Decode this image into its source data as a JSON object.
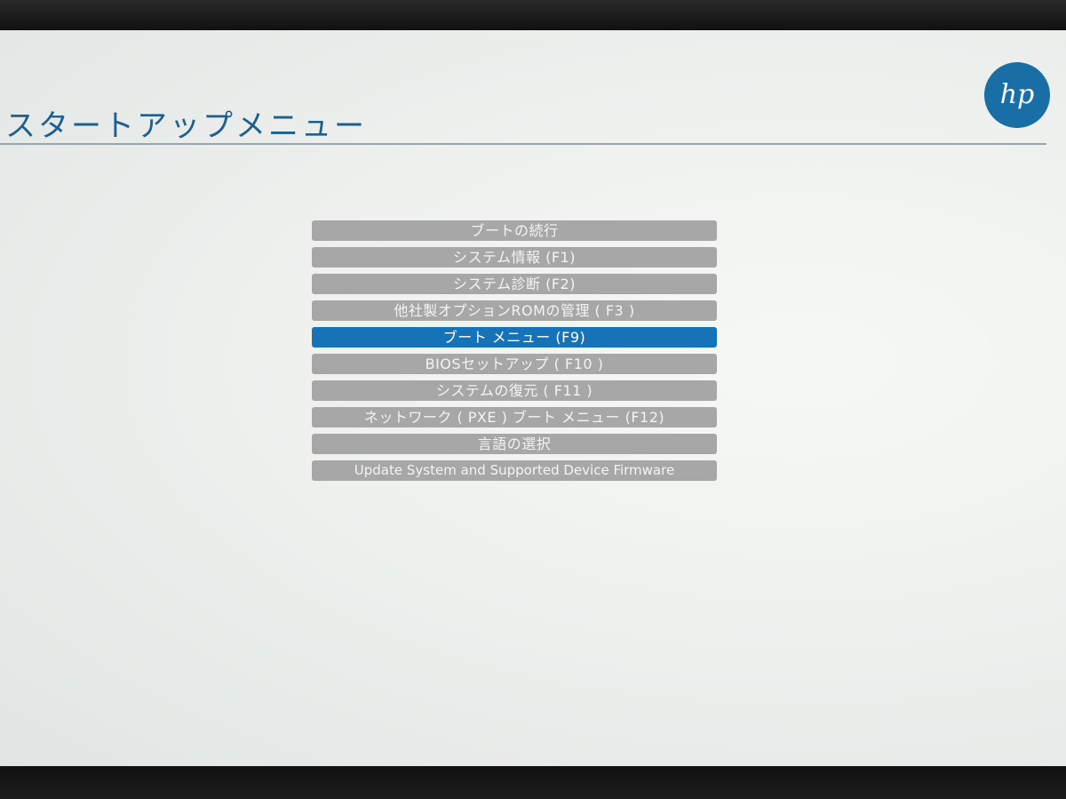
{
  "header": {
    "title": "スタートアップメニュー",
    "logo_icon": "hp-logo-icon"
  },
  "menu": {
    "selected_index": 4,
    "items": [
      {
        "label": "ブートの続行"
      },
      {
        "label": "システム情報 (F1)"
      },
      {
        "label": "システム診断 (F2)"
      },
      {
        "label": "他社製オプションROMの管理 ( F3 )"
      },
      {
        "label": "ブート メニュー (F9)"
      },
      {
        "label": "BIOSセットアップ ( F10 )"
      },
      {
        "label": "システムの復元 ( F11 )"
      },
      {
        "label": "ネットワーク ( PXE ) ブート メニュー (F12)"
      },
      {
        "label": "言語の選択"
      },
      {
        "label": "Update System and Supported Device Firmware"
      }
    ]
  },
  "colors": {
    "title": "#1d5f8f",
    "selected_item": "#1773b8",
    "item": "#a7a7a7",
    "logo": "#1a6ea6"
  }
}
